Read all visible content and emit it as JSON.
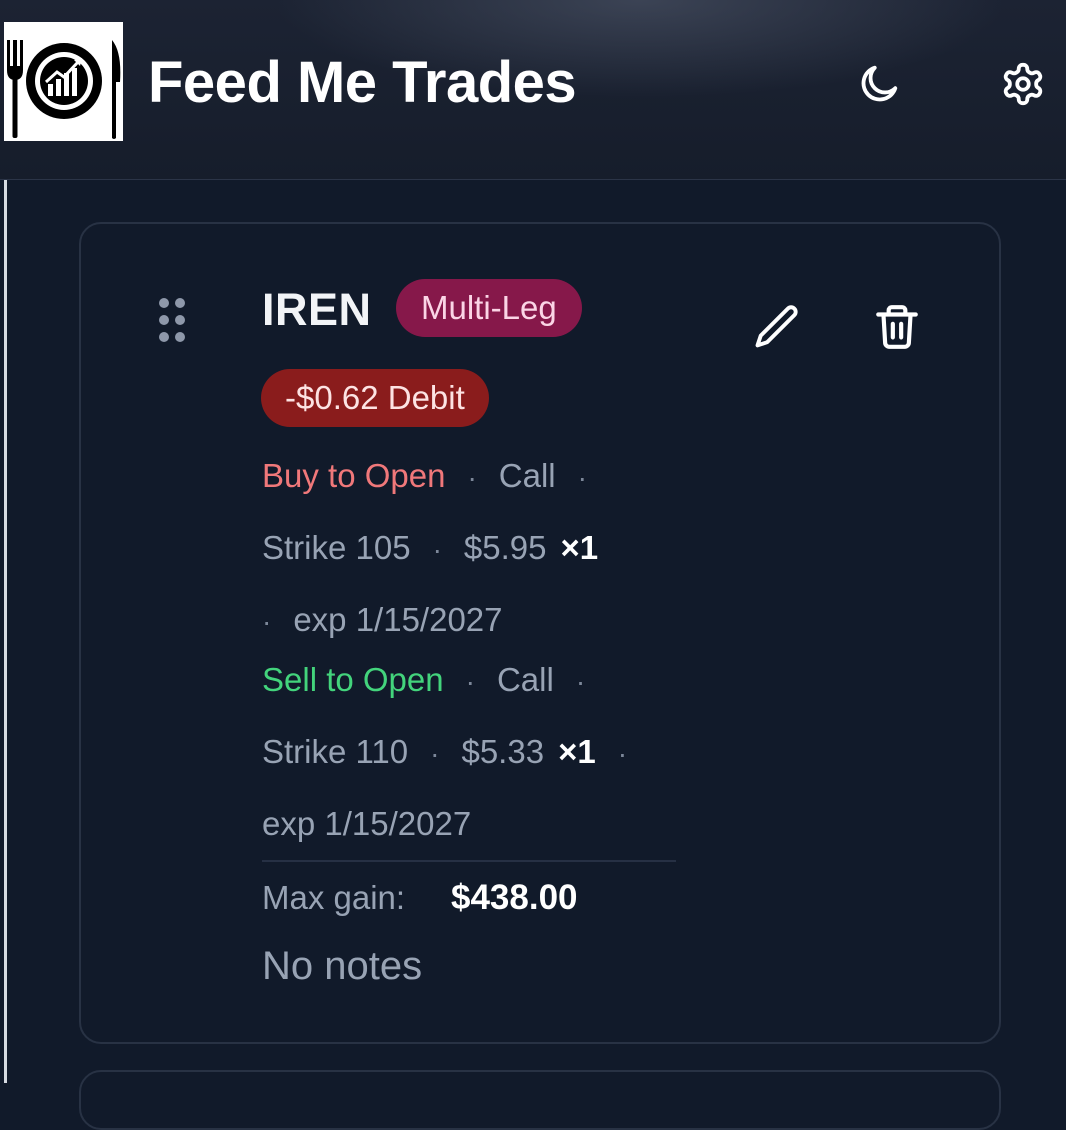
{
  "header": {
    "app_title": "Feed Me Trades",
    "logo_icon": "fork-plate-knife-chart-logo",
    "theme_toggle_icon": "moon-icon",
    "settings_icon": "gear-icon"
  },
  "trade_card": {
    "ticker": "IREN",
    "strategy_badge": "Multi-Leg",
    "net_badge": "-$0.62 Debit",
    "drag_icon": "drag-handle-icon",
    "edit_icon": "pencil-icon",
    "delete_icon": "trash-icon",
    "legs": [
      {
        "action": "Buy to Open",
        "type": "Call",
        "strike": "Strike 105",
        "price": "$5.95",
        "quantity": "×1",
        "expiration": "exp 1/15/2027"
      },
      {
        "action": "Sell to Open",
        "type": "Call",
        "strike": "Strike 110",
        "price": "$5.33",
        "quantity": "×1",
        "expiration": "exp 1/15/2027"
      }
    ],
    "max_gain_label": "Max gain:",
    "max_gain_value": "$438.00",
    "notes": "No notes",
    "separator": "·"
  },
  "colors": {
    "background": "#111a2a",
    "buy_action": "#f0787a",
    "sell_action": "#43d47c",
    "multileg_badge": "#86184a",
    "debit_badge": "#8a1c1c"
  }
}
